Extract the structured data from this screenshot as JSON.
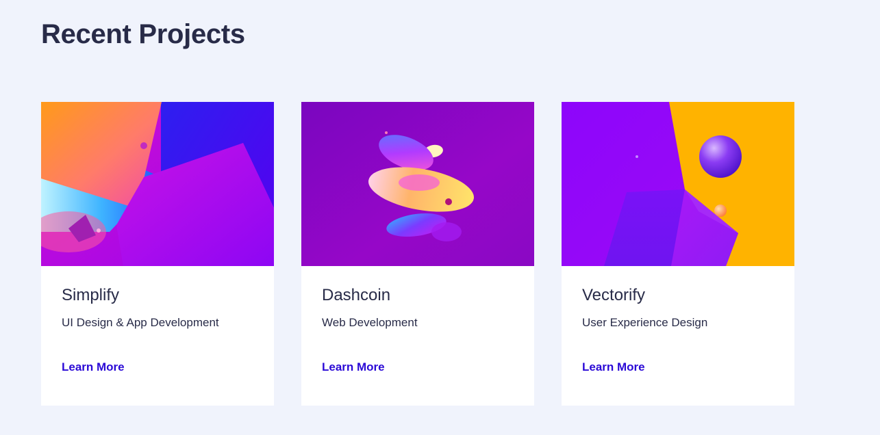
{
  "page": {
    "title": "Recent Projects"
  },
  "projects": [
    {
      "title": "Simplify",
      "subtitle": "UI Design & App Development",
      "link": "Learn More"
    },
    {
      "title": "Dashcoin",
      "subtitle": "Web Development",
      "link": "Learn More"
    },
    {
      "title": "Vectorify",
      "subtitle": "User Experience Design",
      "link": "Learn More"
    }
  ],
  "colors": {
    "background": "#f0f3fc",
    "heading": "#282b48",
    "link": "#2a09d6",
    "card": "#ffffff"
  }
}
